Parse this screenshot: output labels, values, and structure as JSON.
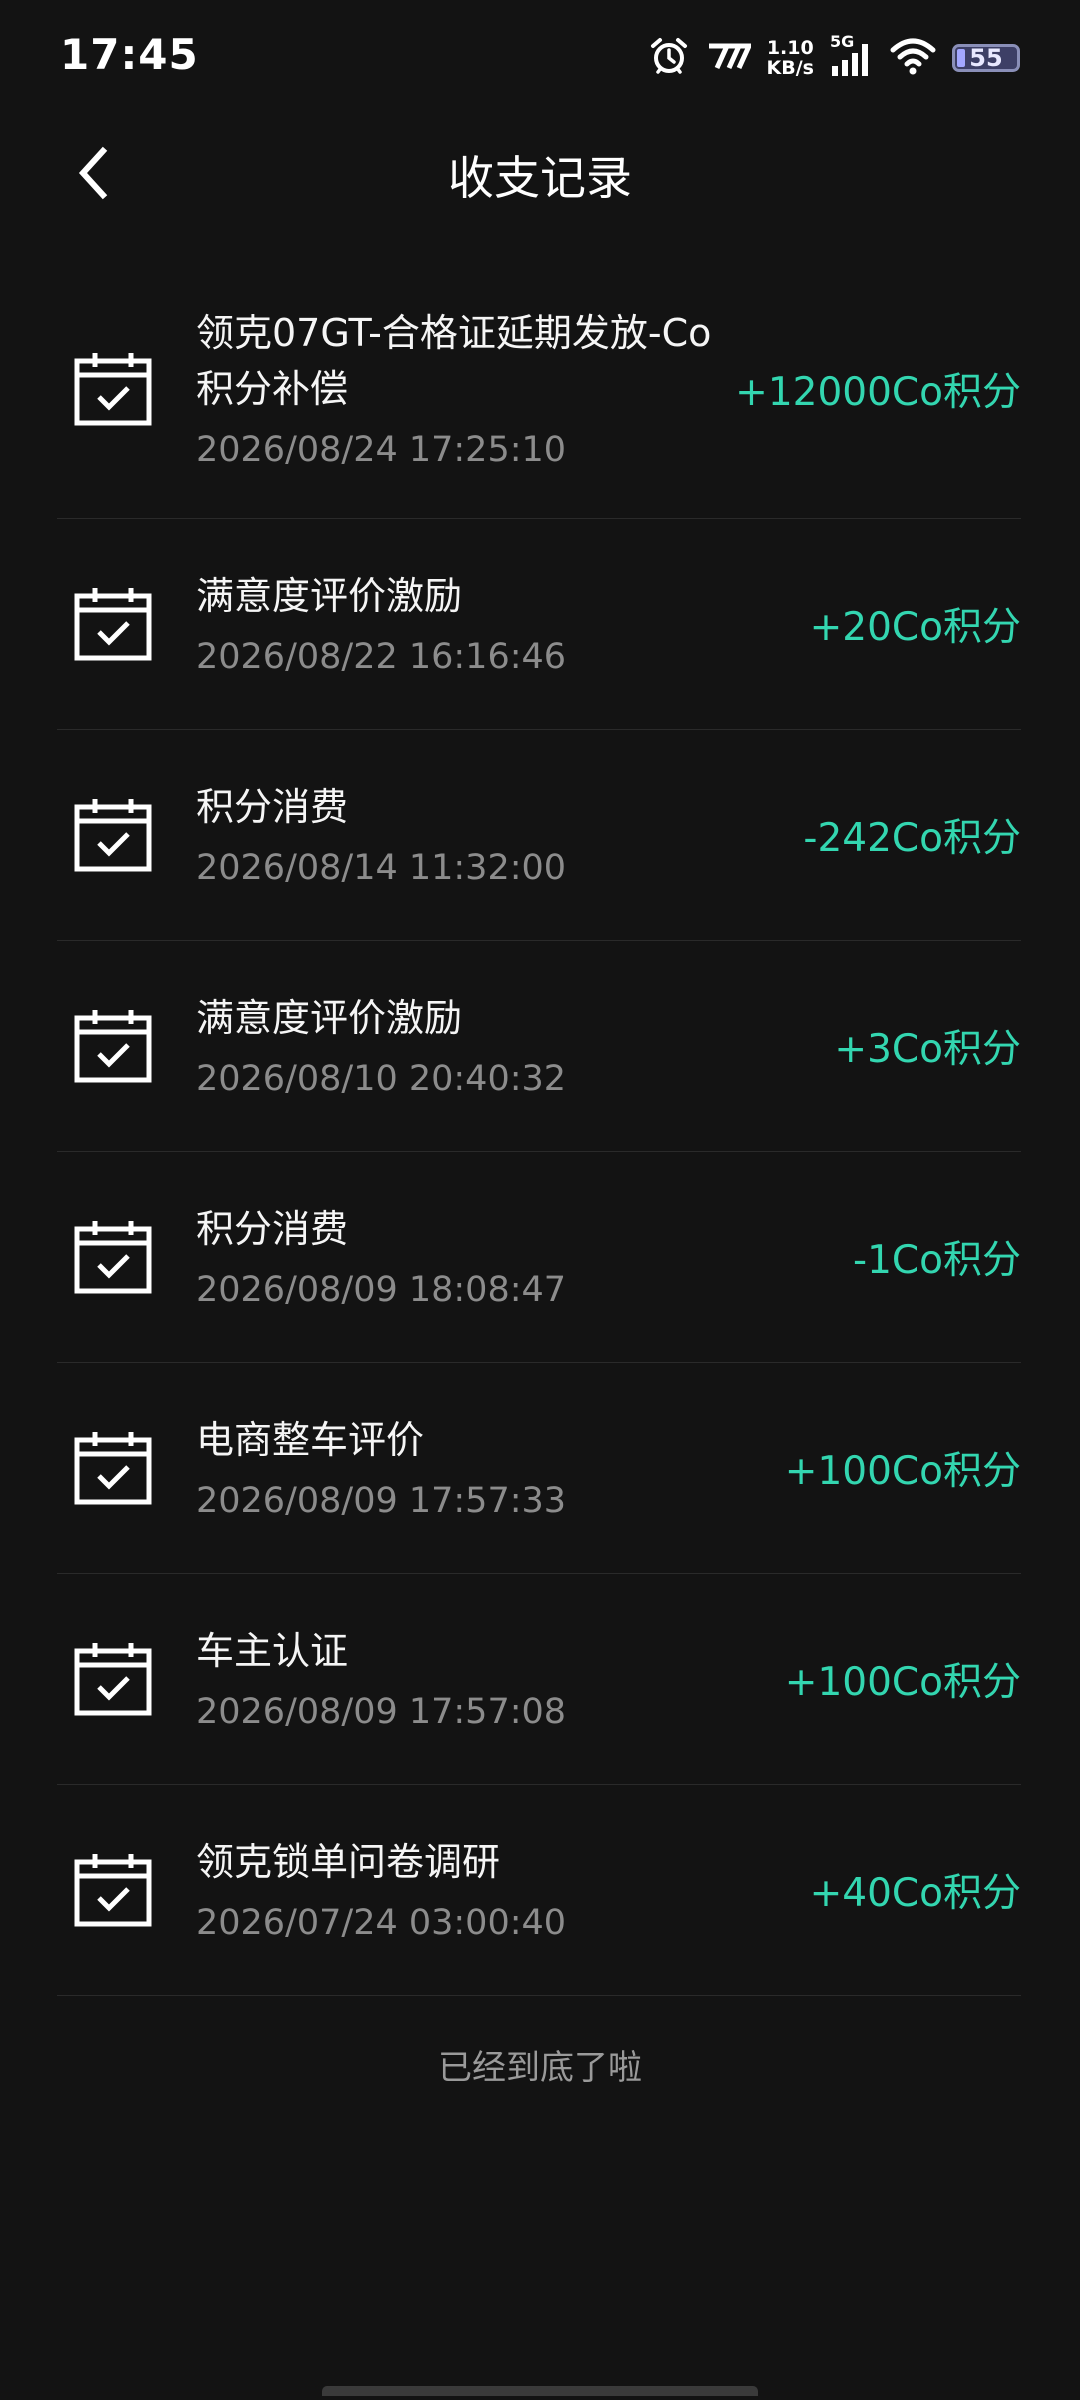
{
  "status_bar": {
    "time": "17:45",
    "net_speed_value": "1.10",
    "net_speed_unit": "KB/s",
    "network_type": "5G",
    "battery": "55"
  },
  "header": {
    "title": "收支记录"
  },
  "records": [
    {
      "title_line1": "领克07GT-合格证延期发放-Co",
      "title_line2": "积分补偿",
      "date": "2026/08/24 17:25:10",
      "amount": "+12000Co积分"
    },
    {
      "title": "满意度评价激励",
      "date": "2026/08/22 16:16:46",
      "amount": "+20Co积分"
    },
    {
      "title": "积分消费",
      "date": "2026/08/14 11:32:00",
      "amount": "-242Co积分"
    },
    {
      "title": "满意度评价激励",
      "date": "2026/08/10 20:40:32",
      "amount": "+3Co积分"
    },
    {
      "title": "积分消费",
      "date": "2026/08/09 18:08:47",
      "amount": "-1Co积分"
    },
    {
      "title": "电商整车评价",
      "date": "2026/08/09 17:57:33",
      "amount": "+100Co积分"
    },
    {
      "title": "车主认证",
      "date": "2026/08/09 17:57:08",
      "amount": "+100Co积分"
    },
    {
      "title": "领克锁单问卷调研",
      "date": "2026/07/24 03:00:40",
      "amount": "+40Co积分"
    }
  ],
  "footer": {
    "end_text": "已经到底了啦"
  },
  "icons": {
    "record": "calendar-check-icon",
    "back": "chevron-left-icon"
  },
  "colors": {
    "background": "#131313",
    "amount": "#33d6b0",
    "date": "#8c8c8c"
  }
}
